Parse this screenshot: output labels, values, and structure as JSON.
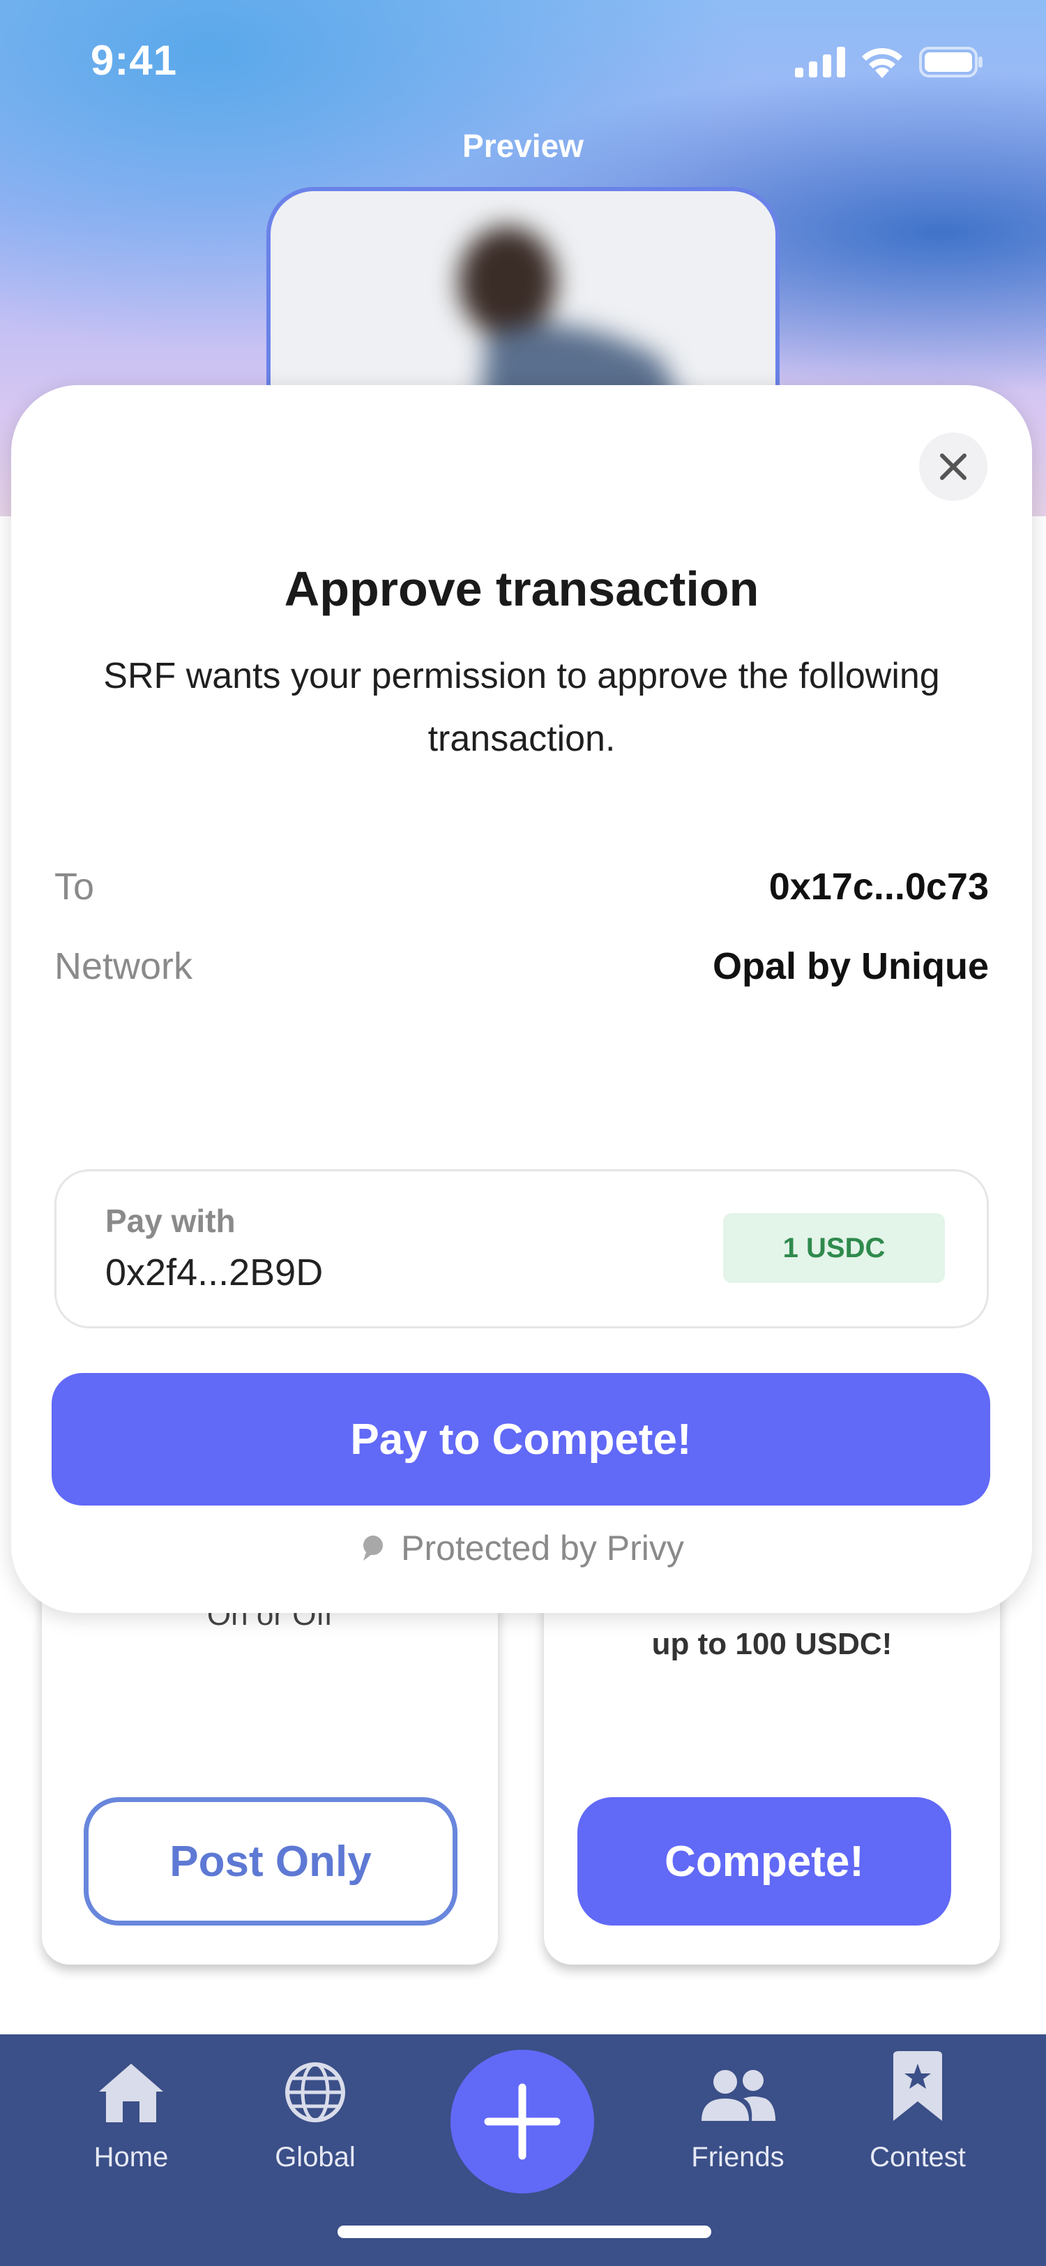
{
  "status_bar": {
    "time": "9:41"
  },
  "preview": {
    "label": "Preview"
  },
  "cards": {
    "left": {
      "description": "On or Off",
      "button_label": "Post Only"
    },
    "right": {
      "description": "up to 100 USDC!",
      "button_label": "Compete!"
    }
  },
  "modal": {
    "title": "Approve transaction",
    "description": "SRF wants your permission to approve the following transaction.",
    "details": [
      {
        "label": "To",
        "value": "0x17c...0c73"
      },
      {
        "label": "Network",
        "value": "Opal by Unique"
      }
    ],
    "pay_with": {
      "label": "Pay with",
      "value": "0x2f4...2B9D",
      "amount_badge": "1 USDC"
    },
    "primary_button": "Pay to Compete!",
    "footer": "Protected by Privy"
  },
  "nav": {
    "items": [
      {
        "label": "Home",
        "icon": "home-icon"
      },
      {
        "label": "Global",
        "icon": "globe-icon"
      },
      {
        "label": "",
        "icon": "plus-icon"
      },
      {
        "label": "Friends",
        "icon": "friends-icon"
      },
      {
        "label": "Contest",
        "icon": "ribbon-icon"
      }
    ]
  },
  "colors": {
    "accent": "#6169f7",
    "nav_background": "#3b4f88",
    "outline_button": "#6886dc",
    "badge_background": "#e3f4e9",
    "badge_text": "#2f8a4d"
  }
}
